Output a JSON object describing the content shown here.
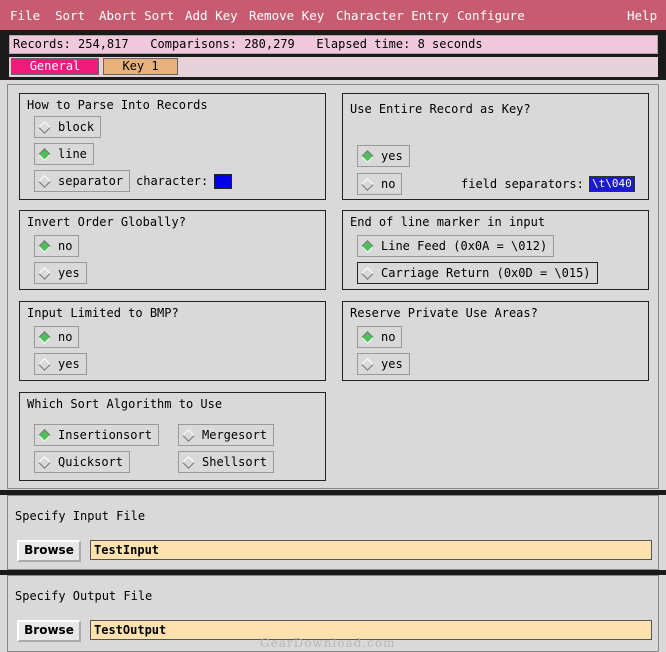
{
  "menu": [
    "File",
    "Sort",
    "Abort Sort",
    "Add Key",
    "Remove Key",
    "Character Entry",
    "Configure",
    "Help"
  ],
  "status": {
    "text": "Records: 254,817   Comparisons: 280,279   Elapsed time: 8 seconds"
  },
  "tabs": [
    {
      "label": "General",
      "active": true
    },
    {
      "label": "Key 1",
      "active": false
    }
  ],
  "groups": {
    "parse": {
      "title": "How to Parse Into Records",
      "options": [
        {
          "label": "block",
          "selected": false
        },
        {
          "label": "line",
          "selected": true
        },
        {
          "label": "separator",
          "selected": false
        }
      ],
      "character_label": "character:",
      "character_color": "#0000ee"
    },
    "entire_key": {
      "title": "Use Entire Record as Key?",
      "options": [
        {
          "label": "yes",
          "selected": true
        },
        {
          "label": "no",
          "selected": false
        }
      ],
      "field_separators_label": "field separators:",
      "field_separators_value": "\\t\\040"
    },
    "invert": {
      "title": "Invert Order Globally?",
      "options": [
        {
          "label": "no",
          "selected": true
        },
        {
          "label": "yes",
          "selected": false
        }
      ]
    },
    "eol": {
      "title": "End of line marker in input",
      "options": [
        {
          "label": "Line Feed (0x0A = \\012)",
          "selected": true
        },
        {
          "label": "Carriage Return (0x0D = \\015)",
          "selected": false
        }
      ]
    },
    "bmp": {
      "title": "Input Limited to BMP?",
      "options": [
        {
          "label": "no",
          "selected": true
        },
        {
          "label": "yes",
          "selected": false
        }
      ]
    },
    "private": {
      "title": "Reserve Private Use Areas?",
      "options": [
        {
          "label": "no",
          "selected": true
        },
        {
          "label": "yes",
          "selected": false
        }
      ]
    },
    "algorithm": {
      "title": "Which Sort Algorithm to Use",
      "options": [
        {
          "label": "Insertionsort",
          "selected": true
        },
        {
          "label": "Mergesort",
          "selected": false
        },
        {
          "label": "Quicksort",
          "selected": false
        },
        {
          "label": "Shellsort",
          "selected": false
        }
      ]
    }
  },
  "input_file": {
    "title": "Specify Input File",
    "browse": "Browse",
    "value": "TestInput"
  },
  "output_file": {
    "title": "Specify Output File",
    "browse": "Browse",
    "value": "TestOutput"
  },
  "watermark": "GearDownload.com",
  "colors": {
    "menubar": "#c75c71",
    "active_tab": "#f01a7a",
    "inactive_tab": "#e6b17a",
    "selected_radio": "#4ec05a"
  }
}
